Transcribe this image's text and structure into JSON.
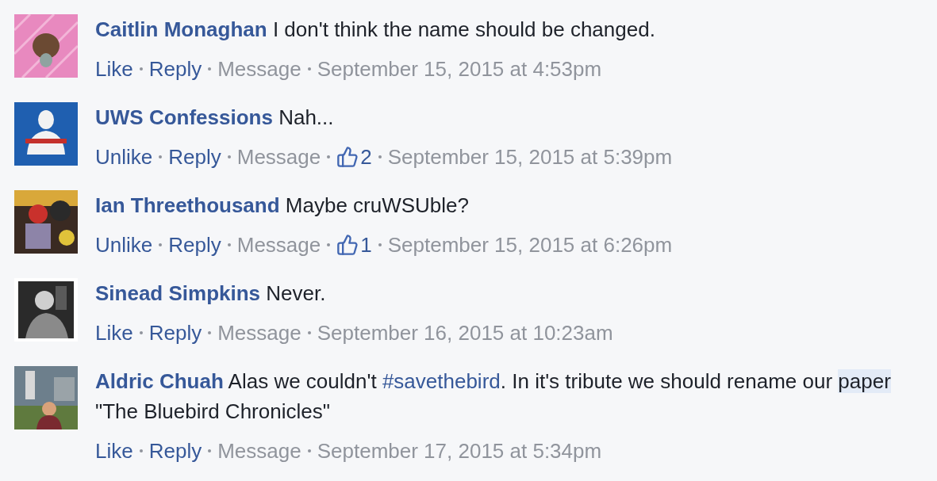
{
  "comments": [
    {
      "author": "Caitlin Monaghan",
      "segments": [
        {
          "kind": "plain",
          "text": "I don't think the name should be changed."
        }
      ],
      "like_label": "Like",
      "reply_label": "Reply",
      "message_label": "Message",
      "time": "September 15, 2015 at 4:53pm"
    },
    {
      "author": "UWS Confessions",
      "segments": [
        {
          "kind": "plain",
          "text": "Nah..."
        }
      ],
      "like_label": "Unlike",
      "reply_label": "Reply",
      "message_label": "Message",
      "likes": "2",
      "time": "September 15, 2015 at 5:39pm"
    },
    {
      "author": "Ian Threethousand",
      "segments": [
        {
          "kind": "plain",
          "text": "Maybe cruWSUble?"
        }
      ],
      "like_label": "Unlike",
      "reply_label": "Reply",
      "message_label": "Message",
      "likes": "1",
      "time": "September 15, 2015 at 6:26pm"
    },
    {
      "author": "Sinead Simpkins",
      "segments": [
        {
          "kind": "plain",
          "text": "Never."
        }
      ],
      "like_label": "Like",
      "reply_label": "Reply",
      "message_label": "Message",
      "time": "September 16, 2015 at 10:23am"
    },
    {
      "author": "Aldric Chuah",
      "segments": [
        {
          "kind": "plain",
          "text": "Alas we couldn't "
        },
        {
          "kind": "hashtag",
          "text": "#savethebird"
        },
        {
          "kind": "plain",
          "text": ". In it's tribute we should rename our "
        },
        {
          "kind": "highlight",
          "text": "paper"
        },
        {
          "kind": "plain",
          "text": " \"The Bluebird Chronicles\""
        }
      ],
      "like_label": "Like",
      "reply_label": "Reply",
      "message_label": "Message",
      "time": "September 17, 2015 at 5:34pm"
    }
  ]
}
